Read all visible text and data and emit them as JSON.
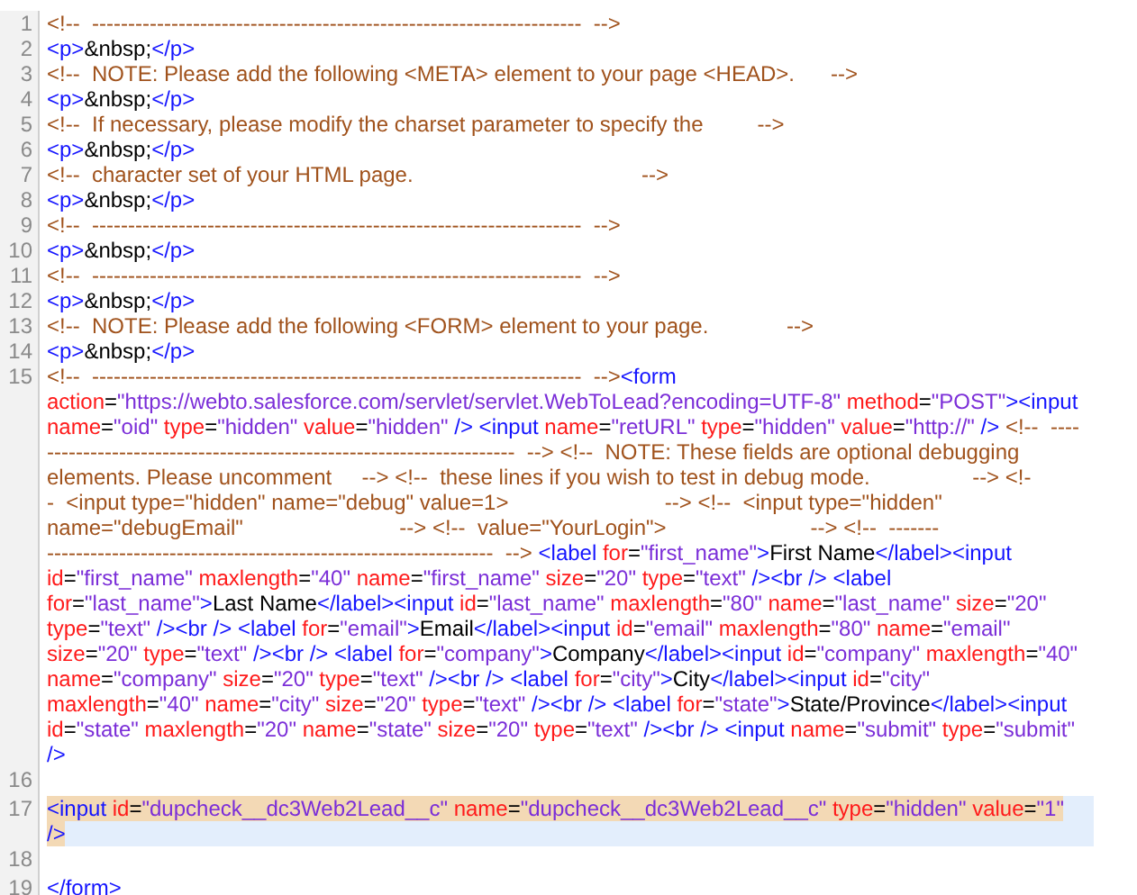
{
  "lines": [
    {
      "number": "1",
      "selected": false,
      "rows": [
        {
          "tokens": [
            {
              "kind": "comment",
              "text": "<!--  --------------------------------------------------------------------  -->"
            }
          ]
        }
      ]
    },
    {
      "number": "2",
      "selected": false,
      "rows": [
        {
          "tokens": [
            {
              "kind": "tag",
              "text": "<p>"
            },
            {
              "kind": "text",
              "text": "&nbsp;"
            },
            {
              "kind": "tag",
              "text": "</p>"
            }
          ]
        }
      ]
    },
    {
      "number": "3",
      "selected": false,
      "rows": [
        {
          "tokens": [
            {
              "kind": "comment",
              "text": "<!--  NOTE: Please add the following <META> element to your page <HEAD>.      -->"
            }
          ]
        }
      ]
    },
    {
      "number": "4",
      "selected": false,
      "rows": [
        {
          "tokens": [
            {
              "kind": "tag",
              "text": "<p>"
            },
            {
              "kind": "text",
              "text": "&nbsp;"
            },
            {
              "kind": "tag",
              "text": "</p>"
            }
          ]
        }
      ]
    },
    {
      "number": "5",
      "selected": false,
      "rows": [
        {
          "tokens": [
            {
              "kind": "comment",
              "text": "<!--  If necessary, please modify the charset parameter to specify the         -->"
            }
          ]
        }
      ]
    },
    {
      "number": "6",
      "selected": false,
      "rows": [
        {
          "tokens": [
            {
              "kind": "tag",
              "text": "<p>"
            },
            {
              "kind": "text",
              "text": "&nbsp;"
            },
            {
              "kind": "tag",
              "text": "</p>"
            }
          ]
        }
      ]
    },
    {
      "number": "7",
      "selected": false,
      "rows": [
        {
          "tokens": [
            {
              "kind": "comment",
              "text": "<!--  character set of your HTML page.                                      -->"
            }
          ]
        }
      ]
    },
    {
      "number": "8",
      "selected": false,
      "rows": [
        {
          "tokens": [
            {
              "kind": "tag",
              "text": "<p>"
            },
            {
              "kind": "text",
              "text": "&nbsp;"
            },
            {
              "kind": "tag",
              "text": "</p>"
            }
          ]
        }
      ]
    },
    {
      "number": "9",
      "selected": false,
      "rows": [
        {
          "tokens": [
            {
              "kind": "comment",
              "text": "<!--  --------------------------------------------------------------------  -->"
            }
          ]
        }
      ]
    },
    {
      "number": "10",
      "selected": false,
      "rows": [
        {
          "tokens": [
            {
              "kind": "tag",
              "text": "<p>"
            },
            {
              "kind": "text",
              "text": "&nbsp;"
            },
            {
              "kind": "tag",
              "text": "</p>"
            }
          ]
        }
      ]
    },
    {
      "number": "11",
      "selected": false,
      "rows": [
        {
          "tokens": [
            {
              "kind": "comment",
              "text": "<!--  --------------------------------------------------------------------  -->"
            }
          ]
        }
      ]
    },
    {
      "number": "12",
      "selected": false,
      "rows": [
        {
          "tokens": [
            {
              "kind": "tag",
              "text": "<p>"
            },
            {
              "kind": "text",
              "text": "&nbsp;"
            },
            {
              "kind": "tag",
              "text": "</p>"
            }
          ]
        }
      ]
    },
    {
      "number": "13",
      "selected": false,
      "rows": [
        {
          "tokens": [
            {
              "kind": "comment",
              "text": "<!--  NOTE: Please add the following <FORM> element to your page.             -->"
            }
          ]
        }
      ]
    },
    {
      "number": "14",
      "selected": false,
      "rows": [
        {
          "tokens": [
            {
              "kind": "tag",
              "text": "<p>"
            },
            {
              "kind": "text",
              "text": "&nbsp;"
            },
            {
              "kind": "tag",
              "text": "</p>"
            }
          ]
        }
      ]
    },
    {
      "number": "15",
      "selected": false,
      "rows": [
        {
          "tokens": [
            {
              "kind": "comment",
              "text": "<!--  --------------------------------------------------------------------  -->"
            },
            {
              "kind": "tag",
              "text": "<form"
            }
          ]
        },
        {
          "tokens": [
            {
              "kind": "attr",
              "text": "action"
            },
            {
              "kind": "text",
              "text": "="
            },
            {
              "kind": "value",
              "text": "\"https://webto.salesforce.com/servlet/servlet.WebToLead?encoding=UTF-8\""
            },
            {
              "kind": "attr",
              "text": " method"
            },
            {
              "kind": "text",
              "text": "="
            },
            {
              "kind": "value",
              "text": "\"POST\""
            },
            {
              "kind": "tag",
              "text": "><input"
            }
          ]
        },
        {
          "tokens": [
            {
              "kind": "attr",
              "text": "name"
            },
            {
              "kind": "text",
              "text": "="
            },
            {
              "kind": "value",
              "text": "\"oid\""
            },
            {
              "kind": "attr",
              "text": " type"
            },
            {
              "kind": "text",
              "text": "="
            },
            {
              "kind": "value",
              "text": "\"hidden\""
            },
            {
              "kind": "attr",
              "text": " value"
            },
            {
              "kind": "text",
              "text": "="
            },
            {
              "kind": "value",
              "text": "\"hidden\""
            },
            {
              "kind": "tag",
              "text": " /> <input"
            },
            {
              "kind": "attr",
              "text": " name"
            },
            {
              "kind": "text",
              "text": "="
            },
            {
              "kind": "value",
              "text": "\"retURL\""
            },
            {
              "kind": "attr",
              "text": " type"
            },
            {
              "kind": "text",
              "text": "="
            },
            {
              "kind": "value",
              "text": "\"hidden\""
            },
            {
              "kind": "attr",
              "text": " value"
            },
            {
              "kind": "text",
              "text": "="
            },
            {
              "kind": "value",
              "text": "\"http://\""
            },
            {
              "kind": "tag",
              "text": " />"
            },
            {
              "kind": "comment",
              "text": " <!--  ----"
            }
          ]
        },
        {
          "tokens": [
            {
              "kind": "comment",
              "text": "-----------------------------------------------------------------  --> <!--  NOTE: These fields are optional debugging"
            }
          ]
        },
        {
          "tokens": [
            {
              "kind": "comment",
              "text": "elements. Please uncomment     --> <!--  these lines if you wish to test in debug mode.                 --> <!-"
            }
          ]
        },
        {
          "tokens": [
            {
              "kind": "comment",
              "text": "-  <input type=\"hidden\" name=\"debug\" value=1>                          --> <!--  <input type=\"hidden\""
            }
          ]
        },
        {
          "tokens": [
            {
              "kind": "comment",
              "text": "name=\"debugEmail\"                          --> <!--  value=\"YourLogin\">                        --> <!--  -------"
            }
          ]
        },
        {
          "tokens": [
            {
              "kind": "comment",
              "text": "--------------------------------------------------------------  -->"
            },
            {
              "kind": "tag",
              "text": " <label"
            },
            {
              "kind": "attr",
              "text": " for"
            },
            {
              "kind": "text",
              "text": "="
            },
            {
              "kind": "value",
              "text": "\"first_name\""
            },
            {
              "kind": "tag",
              "text": ">"
            },
            {
              "kind": "text",
              "text": "First Name"
            },
            {
              "kind": "tag",
              "text": "</label><input"
            }
          ]
        },
        {
          "tokens": [
            {
              "kind": "attr",
              "text": "id"
            },
            {
              "kind": "text",
              "text": "="
            },
            {
              "kind": "value",
              "text": "\"first_name\""
            },
            {
              "kind": "attr",
              "text": " maxlength"
            },
            {
              "kind": "text",
              "text": "="
            },
            {
              "kind": "value",
              "text": "\"40\""
            },
            {
              "kind": "attr",
              "text": " name"
            },
            {
              "kind": "text",
              "text": "="
            },
            {
              "kind": "value",
              "text": "\"first_name\""
            },
            {
              "kind": "attr",
              "text": " size"
            },
            {
              "kind": "text",
              "text": "="
            },
            {
              "kind": "value",
              "text": "\"20\""
            },
            {
              "kind": "attr",
              "text": " type"
            },
            {
              "kind": "text",
              "text": "="
            },
            {
              "kind": "value",
              "text": "\"text\""
            },
            {
              "kind": "tag",
              "text": " /><br /> <label"
            }
          ]
        },
        {
          "tokens": [
            {
              "kind": "attr",
              "text": "for"
            },
            {
              "kind": "text",
              "text": "="
            },
            {
              "kind": "value",
              "text": "\"last_name\""
            },
            {
              "kind": "tag",
              "text": ">"
            },
            {
              "kind": "text",
              "text": "Last Name"
            },
            {
              "kind": "tag",
              "text": "</label><input"
            },
            {
              "kind": "attr",
              "text": " id"
            },
            {
              "kind": "text",
              "text": "="
            },
            {
              "kind": "value",
              "text": "\"last_name\""
            },
            {
              "kind": "attr",
              "text": " maxlength"
            },
            {
              "kind": "text",
              "text": "="
            },
            {
              "kind": "value",
              "text": "\"80\""
            },
            {
              "kind": "attr",
              "text": " name"
            },
            {
              "kind": "text",
              "text": "="
            },
            {
              "kind": "value",
              "text": "\"last_name\""
            },
            {
              "kind": "attr",
              "text": " size"
            },
            {
              "kind": "text",
              "text": "="
            },
            {
              "kind": "value",
              "text": "\"20\""
            }
          ]
        },
        {
          "tokens": [
            {
              "kind": "attr",
              "text": "type"
            },
            {
              "kind": "text",
              "text": "="
            },
            {
              "kind": "value",
              "text": "\"text\""
            },
            {
              "kind": "tag",
              "text": " /><br /> <label"
            },
            {
              "kind": "attr",
              "text": " for"
            },
            {
              "kind": "text",
              "text": "="
            },
            {
              "kind": "value",
              "text": "\"email\""
            },
            {
              "kind": "tag",
              "text": ">"
            },
            {
              "kind": "text",
              "text": "Email"
            },
            {
              "kind": "tag",
              "text": "</label><input"
            },
            {
              "kind": "attr",
              "text": " id"
            },
            {
              "kind": "text",
              "text": "="
            },
            {
              "kind": "value",
              "text": "\"email\""
            },
            {
              "kind": "attr",
              "text": " maxlength"
            },
            {
              "kind": "text",
              "text": "="
            },
            {
              "kind": "value",
              "text": "\"80\""
            },
            {
              "kind": "attr",
              "text": " name"
            },
            {
              "kind": "text",
              "text": "="
            },
            {
              "kind": "value",
              "text": "\"email\""
            }
          ]
        },
        {
          "tokens": [
            {
              "kind": "attr",
              "text": "size"
            },
            {
              "kind": "text",
              "text": "="
            },
            {
              "kind": "value",
              "text": "\"20\""
            },
            {
              "kind": "attr",
              "text": " type"
            },
            {
              "kind": "text",
              "text": "="
            },
            {
              "kind": "value",
              "text": "\"text\""
            },
            {
              "kind": "tag",
              "text": " /><br /> <label"
            },
            {
              "kind": "attr",
              "text": " for"
            },
            {
              "kind": "text",
              "text": "="
            },
            {
              "kind": "value",
              "text": "\"company\""
            },
            {
              "kind": "tag",
              "text": ">"
            },
            {
              "kind": "text",
              "text": "Company"
            },
            {
              "kind": "tag",
              "text": "</label><input"
            },
            {
              "kind": "attr",
              "text": " id"
            },
            {
              "kind": "text",
              "text": "="
            },
            {
              "kind": "value",
              "text": "\"company\""
            },
            {
              "kind": "attr",
              "text": " maxlength"
            },
            {
              "kind": "text",
              "text": "="
            },
            {
              "kind": "value",
              "text": "\"40\""
            }
          ]
        },
        {
          "tokens": [
            {
              "kind": "attr",
              "text": "name"
            },
            {
              "kind": "text",
              "text": "="
            },
            {
              "kind": "value",
              "text": "\"company\""
            },
            {
              "kind": "attr",
              "text": " size"
            },
            {
              "kind": "text",
              "text": "="
            },
            {
              "kind": "value",
              "text": "\"20\""
            },
            {
              "kind": "attr",
              "text": " type"
            },
            {
              "kind": "text",
              "text": "="
            },
            {
              "kind": "value",
              "text": "\"text\""
            },
            {
              "kind": "tag",
              "text": " /><br /> <label"
            },
            {
              "kind": "attr",
              "text": " for"
            },
            {
              "kind": "text",
              "text": "="
            },
            {
              "kind": "value",
              "text": "\"city\""
            },
            {
              "kind": "tag",
              "text": ">"
            },
            {
              "kind": "text",
              "text": "City"
            },
            {
              "kind": "tag",
              "text": "</label><input"
            },
            {
              "kind": "attr",
              "text": " id"
            },
            {
              "kind": "text",
              "text": "="
            },
            {
              "kind": "value",
              "text": "\"city\""
            }
          ]
        },
        {
          "tokens": [
            {
              "kind": "attr",
              "text": "maxlength"
            },
            {
              "kind": "text",
              "text": "="
            },
            {
              "kind": "value",
              "text": "\"40\""
            },
            {
              "kind": "attr",
              "text": " name"
            },
            {
              "kind": "text",
              "text": "="
            },
            {
              "kind": "value",
              "text": "\"city\""
            },
            {
              "kind": "attr",
              "text": " size"
            },
            {
              "kind": "text",
              "text": "="
            },
            {
              "kind": "value",
              "text": "\"20\""
            },
            {
              "kind": "attr",
              "text": " type"
            },
            {
              "kind": "text",
              "text": "="
            },
            {
              "kind": "value",
              "text": "\"text\""
            },
            {
              "kind": "tag",
              "text": " /><br /> <label"
            },
            {
              "kind": "attr",
              "text": " for"
            },
            {
              "kind": "text",
              "text": "="
            },
            {
              "kind": "value",
              "text": "\"state\""
            },
            {
              "kind": "tag",
              "text": ">"
            },
            {
              "kind": "text",
              "text": "State/Province"
            },
            {
              "kind": "tag",
              "text": "</label><input"
            }
          ]
        },
        {
          "tokens": [
            {
              "kind": "attr",
              "text": "id"
            },
            {
              "kind": "text",
              "text": "="
            },
            {
              "kind": "value",
              "text": "\"state\""
            },
            {
              "kind": "attr",
              "text": " maxlength"
            },
            {
              "kind": "text",
              "text": "="
            },
            {
              "kind": "value",
              "text": "\"20\""
            },
            {
              "kind": "attr",
              "text": " name"
            },
            {
              "kind": "text",
              "text": "="
            },
            {
              "kind": "value",
              "text": "\"state\""
            },
            {
              "kind": "attr",
              "text": " size"
            },
            {
              "kind": "text",
              "text": "="
            },
            {
              "kind": "value",
              "text": "\"20\""
            },
            {
              "kind": "attr",
              "text": " type"
            },
            {
              "kind": "text",
              "text": "="
            },
            {
              "kind": "value",
              "text": "\"text\""
            },
            {
              "kind": "tag",
              "text": " /><br /> <input"
            },
            {
              "kind": "attr",
              "text": " name"
            },
            {
              "kind": "text",
              "text": "="
            },
            {
              "kind": "value",
              "text": "\"submit\""
            },
            {
              "kind": "attr",
              "text": " type"
            },
            {
              "kind": "text",
              "text": "="
            },
            {
              "kind": "value",
              "text": "\"submit\""
            }
          ]
        },
        {
          "tokens": [
            {
              "kind": "tag",
              "text": "/>"
            }
          ]
        }
      ]
    },
    {
      "number": "16",
      "selected": false
    },
    {
      "number": "17",
      "selected": true,
      "rows": [
        {
          "tokens": [
            {
              "kind": "tag",
              "text": "<input"
            },
            {
              "kind": "attr",
              "text": " id"
            },
            {
              "kind": "text",
              "text": "="
            },
            {
              "kind": "value",
              "text": "\"dupcheck__dc3Web2Lead__c\""
            },
            {
              "kind": "attr",
              "text": " name"
            },
            {
              "kind": "text",
              "text": "="
            },
            {
              "kind": "value",
              "text": "\"dupcheck__dc3Web2Lead__c\""
            },
            {
              "kind": "attr",
              "text": " type"
            },
            {
              "kind": "text",
              "text": "="
            },
            {
              "kind": "value",
              "text": "\"hidden\""
            },
            {
              "kind": "attr",
              "text": " value"
            },
            {
              "kind": "text",
              "text": "="
            },
            {
              "kind": "value",
              "text": "\"1\""
            }
          ]
        },
        {
          "tokens": [
            {
              "kind": "tag",
              "text": "/>"
            }
          ]
        }
      ]
    },
    {
      "number": "18",
      "selected": false
    },
    {
      "number": "19",
      "selected": false,
      "rows": [
        {
          "tokens": [
            {
              "kind": "tag",
              "text": "</form>"
            }
          ]
        }
      ]
    }
  ]
}
